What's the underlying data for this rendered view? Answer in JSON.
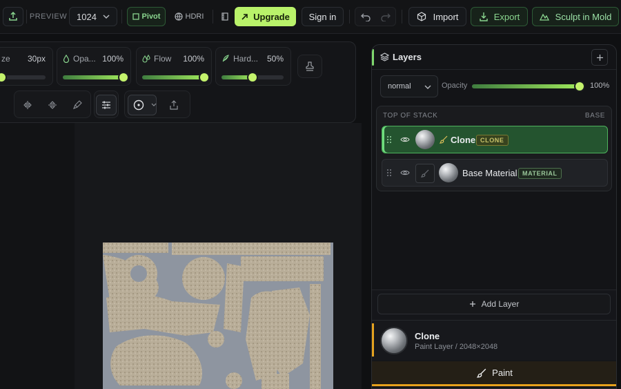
{
  "topbar": {
    "preview_label": "PREVIEW",
    "resolution_value": "1024",
    "pivot_label": "Pivot",
    "hdri_label": "HDRI",
    "upgrade_label": "Upgrade",
    "signin_label": "Sign in",
    "import_label": "Import",
    "export_label": "Export",
    "sculpt_label": "Sculpt in Mold"
  },
  "brush": {
    "size": {
      "label": "ze",
      "value": "30px",
      "level": 0.0
    },
    "opacity": {
      "label": "Opa...",
      "value": "100%",
      "level": 1.0
    },
    "flow": {
      "label": "Flow",
      "value": "100%",
      "level": 1.0
    },
    "hardness": {
      "label": "Hard...",
      "value": "50%",
      "level": 0.5
    }
  },
  "layers_panel": {
    "title": "Layers",
    "add_icon": "plus-icon",
    "blend_mode": "normal",
    "opacity_label": "Opacity",
    "opacity_value": "100%",
    "opacity_level": 1.0,
    "stack_top_label": "TOP OF STACK",
    "stack_base_label": "BASE",
    "layers": [
      {
        "name": "Clone",
        "tag": "CLONE",
        "selected": true
      },
      {
        "name": "Base Material",
        "tag": "MATERIAL",
        "selected": false
      }
    ],
    "add_layer_label": "Add Layer"
  },
  "selected_layer": {
    "name": "Clone",
    "subtitle": "Paint Layer / 2048×2048"
  },
  "paint_label": "Paint",
  "colors": {
    "accent_green": "#b9f26a",
    "selected_layer": "#24542f",
    "paint_accent": "#e7a21c"
  }
}
